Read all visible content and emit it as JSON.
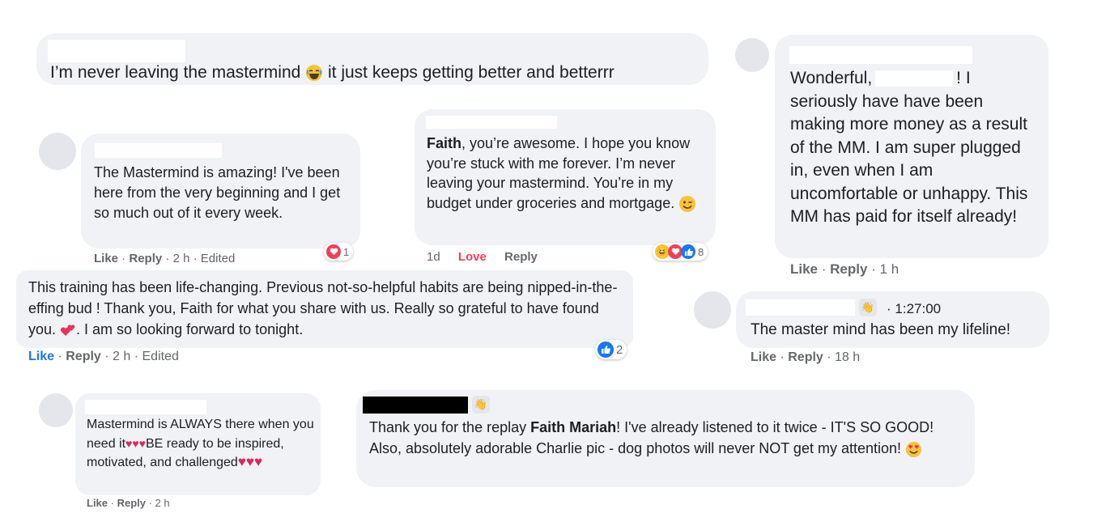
{
  "comments": {
    "c1": {
      "before": "I’m never leaving the mastermind",
      "after": "it just keeps getting better and betterrr"
    },
    "c2": {
      "text_start": "Wonderful,",
      "text_after_name": "! I seriously have have been making more money as a result of the MM. I am super plugged in, even when I am uncomfortable or unhappy. This MM has paid for itself already!",
      "like": "Like",
      "reply": "Reply",
      "time": "1 h"
    },
    "c3": {
      "text": "The Mastermind is amazing! I've been here from the very beginning and I get so much out of it every week.",
      "like": "Like",
      "reply": "Reply",
      "time": "2 h",
      "edited": "Edited",
      "reaction_count": "1"
    },
    "c4": {
      "name": "Faith",
      "text": ", you’re awesome. I hope you know you’re stuck with me forever. I’m never leaving your mastermind. You’re in my budget under groceries and mortgage.",
      "time": "1d",
      "love": "Love",
      "reply": "Reply",
      "reaction_count": "8"
    },
    "c5": {
      "text_a": "This training has been life-changing. Previous not-so-helpful habits are being nipped-in-the-effing bud ! Thank you, Faith for what you share with us. Really so grateful to have found you.",
      "text_b": ". I am so looking forward to tonight.",
      "like": "Like",
      "reply": "Reply",
      "time": "2 h",
      "edited": "Edited",
      "reaction_count": "2"
    },
    "c6": {
      "timestamp": "1:27:00",
      "text": "The master mind has been my lifeline!",
      "like": "Like",
      "reply": "Reply",
      "time": "18 h"
    },
    "c7": {
      "text_a": "Mastermind is ALWAYS there when you need it",
      "text_b": "BE ready to be inspired, motivated, and challenged",
      "like": "Like",
      "reply": "Reply",
      "time": "2 h"
    },
    "c8": {
      "text_a": "Thank you for the replay ",
      "name": "Faith Mariah",
      "text_b": "! I've already listened to it twice - IT'S SO GOOD! Also, absolutely adorable Charlie pic - dog photos will never NOT get my attention!"
    }
  },
  "colors": {
    "bubble": "#f0f2f5",
    "meta": "#65676b",
    "like_blue": "#1877f2",
    "love_red": "#f33e58"
  },
  "icons": [
    "laughing-emoji-icon",
    "winking-emoji-icon",
    "hearts-emoji-icon",
    "red-heart-icon",
    "wave-badge-icon",
    "like-reaction-icon",
    "love-reaction-icon",
    "heart-eyes-emoji-icon"
  ]
}
